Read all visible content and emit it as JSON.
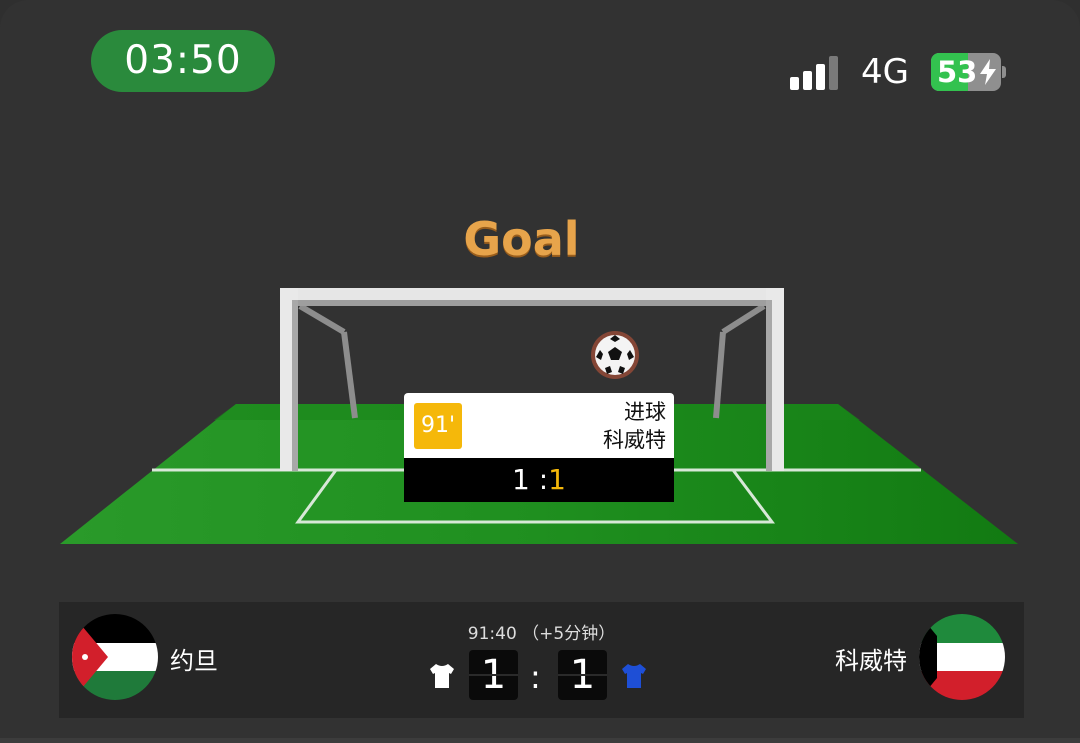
{
  "status_bar": {
    "time": "03:50",
    "network": "4G",
    "battery_level": "53",
    "battery_percent": 53,
    "signal_bars": 3,
    "signal_bars_total": 4
  },
  "scene": {
    "title": "Goal",
    "event": {
      "minute": "91'",
      "type": "进球",
      "team": "科威特",
      "score_home": "1",
      "score_sep": ":",
      "score_away": "1"
    }
  },
  "scoreboard": {
    "home_team": "约旦",
    "away_team": "科威特",
    "clock": "91:40  （+5分钟）",
    "home_score": "1",
    "separator": ":",
    "away_score": "1",
    "home_kit_color": "#ffffff",
    "away_kit_color": "#1e4fd6"
  },
  "colors": {
    "clock_pill": "#2a8a3c",
    "goal_title": "#e7a44b",
    "minute_badge": "#f5b80a",
    "pitch": "#1f8a1f"
  }
}
